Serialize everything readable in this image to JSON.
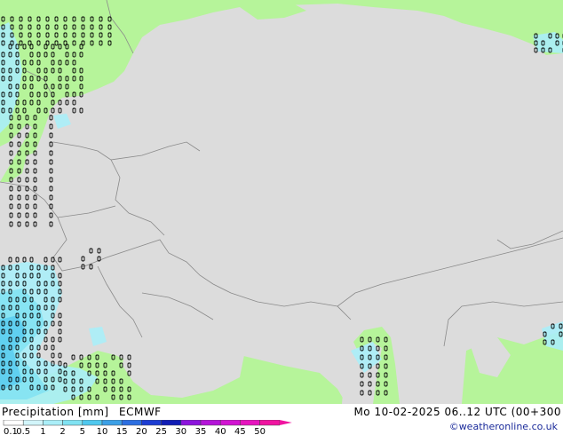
{
  "footer": {
    "title": "Precipitation [mm]",
    "model": "ECMWF",
    "datetime": "Mo 10-02-2025 06..12 UTC (00+300",
    "credit": "©weatheronline.co.uk"
  },
  "legend": {
    "labels": [
      "0.1",
      "0.5",
      "1",
      "2",
      "5",
      "10",
      "15",
      "20",
      "25",
      "30",
      "35",
      "40",
      "45",
      "50"
    ],
    "colors": [
      "#ffffff",
      "#d2f5fa",
      "#aaeef8",
      "#80e2f2",
      "#50c8ee",
      "#3ca0e6",
      "#2c6ee0",
      "#1c3cd2",
      "#101cb4",
      "#8c14dc",
      "#b414d8",
      "#d214d2",
      "#e614be",
      "#f014a0"
    ]
  },
  "map": {
    "land_color": "#b6f49a",
    "sea_color": "#dcdcdc",
    "border_color": "#8a8a8a"
  }
}
